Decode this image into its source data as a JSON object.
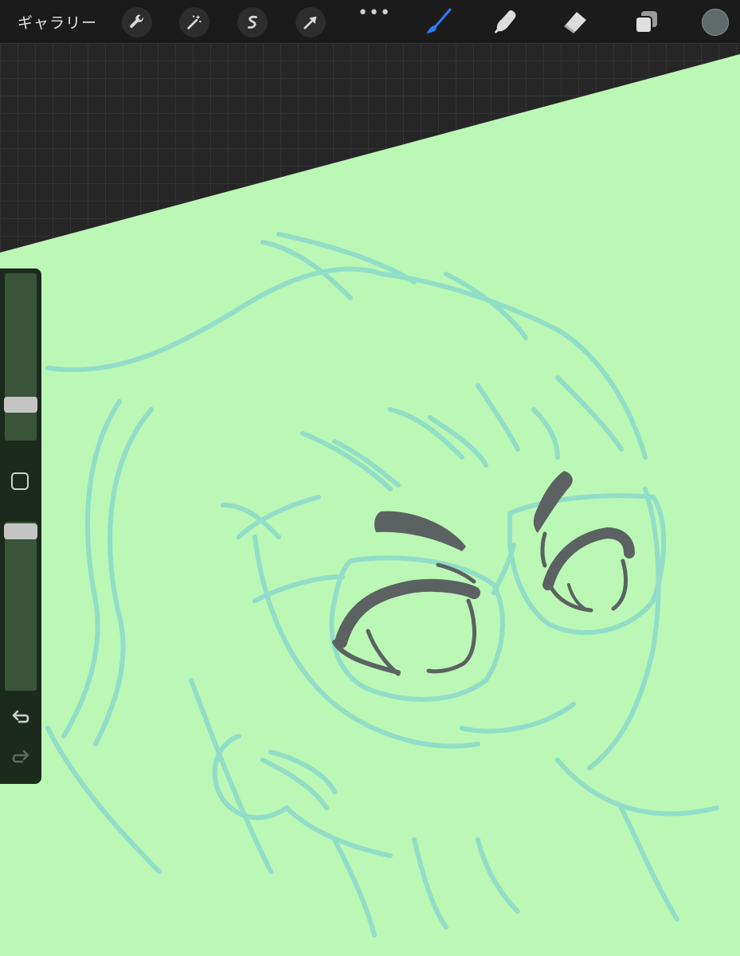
{
  "topbar": {
    "gallery_label": "ギャラリー",
    "tools_left": [
      {
        "name": "actions-wrench",
        "icon": "wrench-icon"
      },
      {
        "name": "adjustments-wand",
        "icon": "magic-wand-icon"
      },
      {
        "name": "selection",
        "icon": "selection-s-icon"
      },
      {
        "name": "transform",
        "icon": "arrow-cursor-icon"
      }
    ],
    "more_label": "•••",
    "tools_right": [
      {
        "name": "brush",
        "icon": "brush-icon",
        "active": true
      },
      {
        "name": "smudge",
        "icon": "smudge-finger-icon",
        "active": false
      },
      {
        "name": "eraser",
        "icon": "eraser-icon",
        "active": false
      },
      {
        "name": "layers",
        "icon": "layers-icon",
        "active": false
      }
    ],
    "active_color": "#606a6b"
  },
  "sidebar": {
    "brush_size_level": 0.77,
    "opacity_level": 0.95,
    "undo_icon": "undo-arrow-icon",
    "redo_icon": "redo-arrow-icon",
    "modify_icon": "square-modify-icon"
  },
  "colors": {
    "canvas_fill": "#bbf7b5",
    "sketch_line": "#8fdcc9",
    "ink_line": "#5b6261",
    "active_tool": "#2e7cf6"
  }
}
